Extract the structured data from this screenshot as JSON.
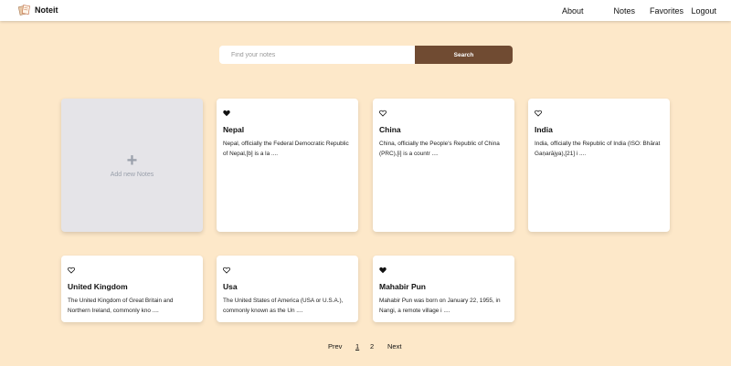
{
  "app": {
    "name": "Noteit"
  },
  "nav": {
    "about": "About",
    "notes": "Notes",
    "favorites": "Favorites",
    "logout": "Logout"
  },
  "search": {
    "placeholder": "Find your notes",
    "button": "Search",
    "value": ""
  },
  "add_card": {
    "plus": "+",
    "label": "Add new Notes"
  },
  "notes": [
    {
      "title": "Nepal",
      "text": "Nepal, officially the Federal Democratic Republic of Nepal,[b] is a la ....",
      "favorite": true
    },
    {
      "title": "China",
      "text": "China, officially the People's Republic of China (PRC),[i] is a countr ....",
      "favorite": false
    },
    {
      "title": "India",
      "text": "India, officially the Republic of India (ISO: Bhārat Gaṇarājya),[21] i ....",
      "favorite": false
    },
    {
      "title": "United Kingdom",
      "text": "The United Kingdom of Great Britain and Northern Ireland, commonly kno ....",
      "favorite": false
    },
    {
      "title": "Usa",
      "text": "The United States of America (USA or U.S.A.), commonly known as the Un ....",
      "favorite": false
    },
    {
      "title": "Mahabir Pun",
      "text": "Mahabir Pun was born on January 22, 1955, in Nangi, a remote village i ....",
      "favorite": true
    }
  ],
  "pagination": {
    "prev": "Prev",
    "pages": [
      "1",
      "2"
    ],
    "current": "1",
    "next": "Next"
  },
  "colors": {
    "background": "#fde8c9",
    "accent": "#704b32",
    "card": "#ffffff",
    "add_card": "#e5e4e8"
  },
  "icons": {
    "logo": "notebook-logo-icon",
    "favorite_filled": "heart-filled-icon",
    "favorite_empty": "heart-outline-icon",
    "add": "plus-icon"
  }
}
